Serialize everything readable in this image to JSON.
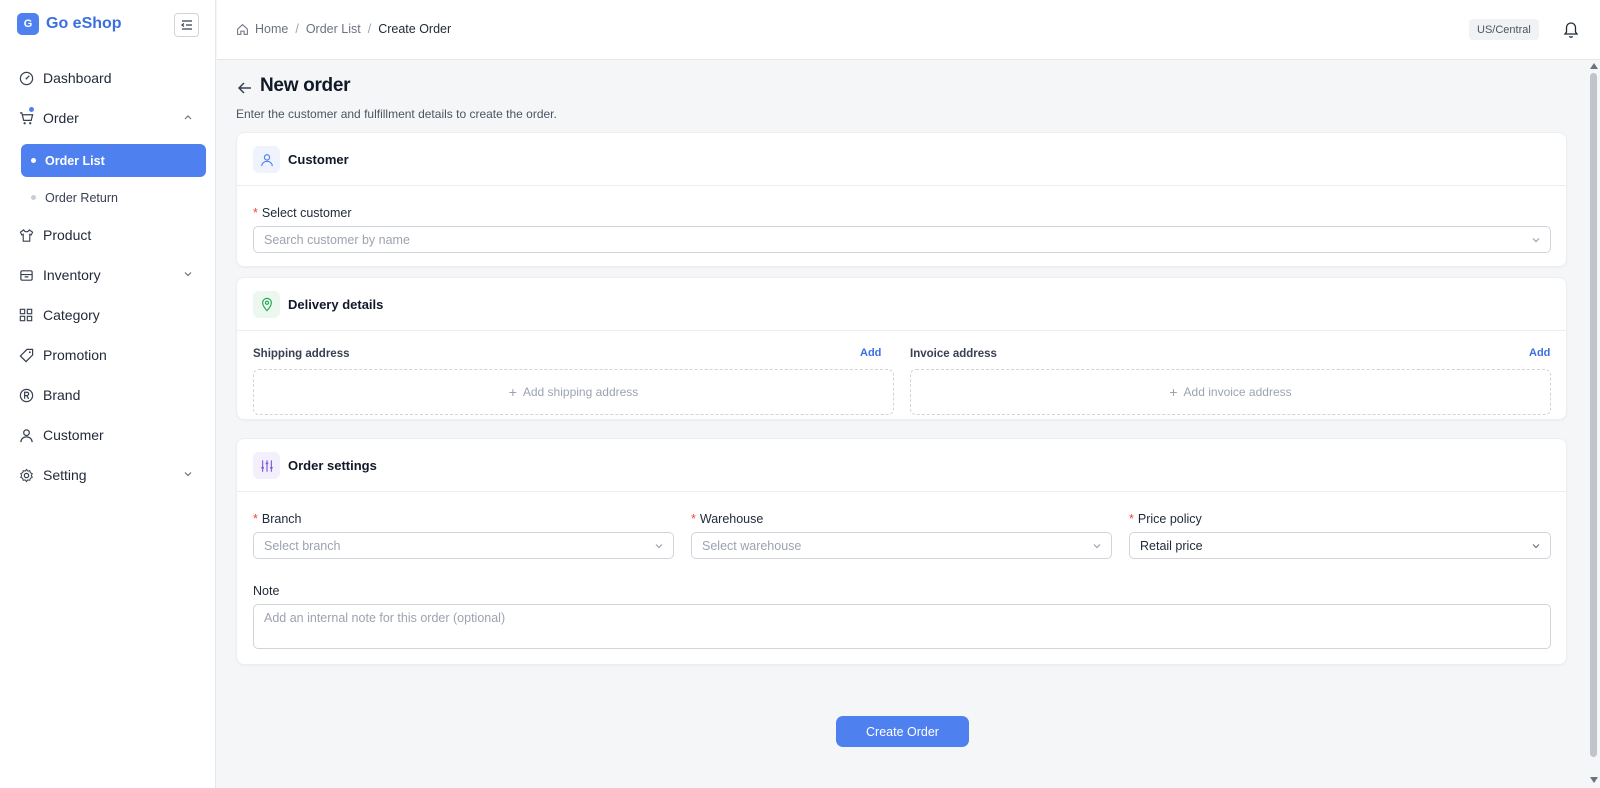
{
  "brand": {
    "logo_letter": "G",
    "name": "Go eShop"
  },
  "sidebar": {
    "items": [
      {
        "label": "Dashboard"
      },
      {
        "label": "Order"
      },
      {
        "label": "Product"
      },
      {
        "label": "Inventory"
      },
      {
        "label": "Category"
      },
      {
        "label": "Promotion"
      },
      {
        "label": "Brand"
      },
      {
        "label": "Customer"
      },
      {
        "label": "Setting"
      }
    ],
    "order_sub": [
      {
        "label": "Order List"
      },
      {
        "label": "Order Return"
      }
    ]
  },
  "header": {
    "breadcrumb": [
      "Home",
      "Order List",
      "Create Order"
    ],
    "timezone": "US/Central"
  },
  "page": {
    "title": "New order",
    "subtitle": "Enter the customer and fulfillment details to create the order."
  },
  "customer_card": {
    "title": "Customer",
    "label": "Select customer",
    "placeholder": "Search customer by name"
  },
  "delivery_card": {
    "title": "Delivery details",
    "shipping_label": "Shipping address",
    "shipping_add": "Add",
    "shipping_placeholder": "Add shipping address",
    "invoice_label": "Invoice address",
    "invoice_add": "Add",
    "invoice_placeholder": "Add invoice address"
  },
  "settings_card": {
    "title": "Order settings",
    "branch_label": "Branch",
    "branch_placeholder": "Select branch",
    "warehouse_label": "Warehouse",
    "warehouse_placeholder": "Select warehouse",
    "price_label": "Price policy",
    "price_value": "Retail price",
    "note_label": "Note",
    "note_placeholder": "Add an internal note for this order (optional)"
  },
  "actions": {
    "create": "Create Order"
  },
  "colors": {
    "accent": "#4f80f0",
    "required": "#ef4444"
  }
}
